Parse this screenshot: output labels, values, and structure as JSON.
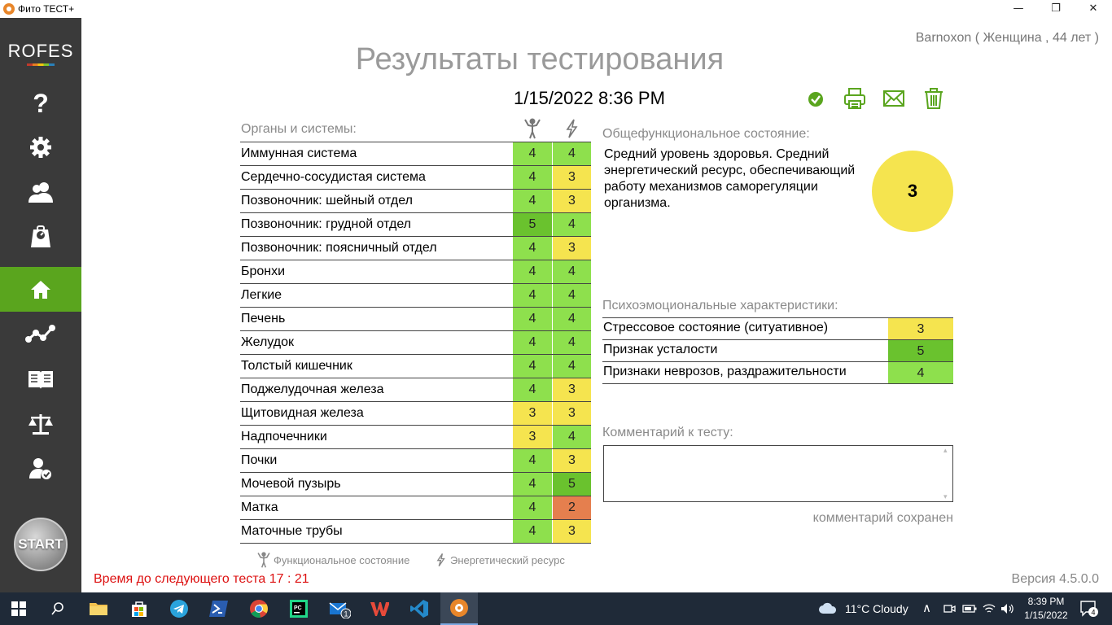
{
  "window": {
    "title": "Фито ТЕСТ+"
  },
  "sidebar": {
    "logo": "ROFES",
    "items": [
      {
        "icon": "help-icon"
      },
      {
        "icon": "gear-icon"
      },
      {
        "icon": "users-icon"
      },
      {
        "icon": "scale-icon"
      },
      {
        "icon": "home-icon",
        "active": true
      },
      {
        "icon": "graph-icon"
      },
      {
        "icon": "book-icon"
      },
      {
        "icon": "balance-icon"
      },
      {
        "icon": "user-check-icon"
      }
    ],
    "start_label": "START"
  },
  "header": {
    "user": "Barnoxon ( Женщина , 44 лет )",
    "title": "Результаты тестирования",
    "date": "1/15/2022 8:36 PM"
  },
  "colors": {
    "green_light": "#8ee04d",
    "green_dark": "#6ac22e",
    "yellow": "#f5e44f",
    "orange": "#e57f4e",
    "accent": "#5aa51e"
  },
  "organs": {
    "header": "Органы и системы:",
    "rows": [
      {
        "name": "Иммунная система",
        "f": "4",
        "e": "4"
      },
      {
        "name": "Сердечно-сосудистая система",
        "f": "4",
        "e": "3"
      },
      {
        "name": "Позвоночник: шейный отдел",
        "f": "4",
        "e": "3"
      },
      {
        "name": "Позвоночник: грудной отдел",
        "f": "5",
        "e": "4"
      },
      {
        "name": "Позвоночник: поясничный отдел",
        "f": "4",
        "e": "3"
      },
      {
        "name": "Бронхи",
        "f": "4",
        "e": "4"
      },
      {
        "name": "Легкие",
        "f": "4",
        "e": "4"
      },
      {
        "name": "Печень",
        "f": "4",
        "e": "4"
      },
      {
        "name": "Желудок",
        "f": "4",
        "e": "4"
      },
      {
        "name": "Толстый кишечник",
        "f": "4",
        "e": "4"
      },
      {
        "name": "Поджелудочная железа",
        "f": "4",
        "e": "3"
      },
      {
        "name": "Щитовидная железа",
        "f": "3",
        "e": "3"
      },
      {
        "name": "Надпочечники",
        "f": "3",
        "e": "4"
      },
      {
        "name": "Почки",
        "f": "4",
        "e": "3"
      },
      {
        "name": "Мочевой пузырь",
        "f": "4",
        "e": "5"
      },
      {
        "name": "Матка",
        "f": "4",
        "e": "2"
      },
      {
        "name": "Маточные трубы",
        "f": "4",
        "e": "3"
      }
    ]
  },
  "overall": {
    "header": "Общефункциональное состояние:",
    "text": "Средний уровень здоровья. Средний энергетический ресурс, обеспечивающий работу механизмов саморегуляции организма.",
    "level": "3"
  },
  "psycho": {
    "header": "Психоэмоциональные характеристики:",
    "rows": [
      {
        "name": "Стрессовое состояние (ситуативное)",
        "value": "3"
      },
      {
        "name": "Признак усталости",
        "value": "5"
      },
      {
        "name": "Признаки неврозов, раздражительности",
        "value": "4"
      }
    ]
  },
  "comment": {
    "header": "Комментарий к тесту:",
    "value": "",
    "saved": "комментарий сохранен"
  },
  "legend": {
    "functional": "Функциональное состояние",
    "energy": "Энергетический ресурс"
  },
  "footer": {
    "timer": "Время до следующего теста 17 : 21",
    "version": "Версия 4.5.0.0"
  },
  "taskbar": {
    "weather": "11°C  Cloudy",
    "time": "8:39 PM",
    "date": "1/15/2022",
    "mail_badge": "1",
    "notif_badge": "4"
  }
}
